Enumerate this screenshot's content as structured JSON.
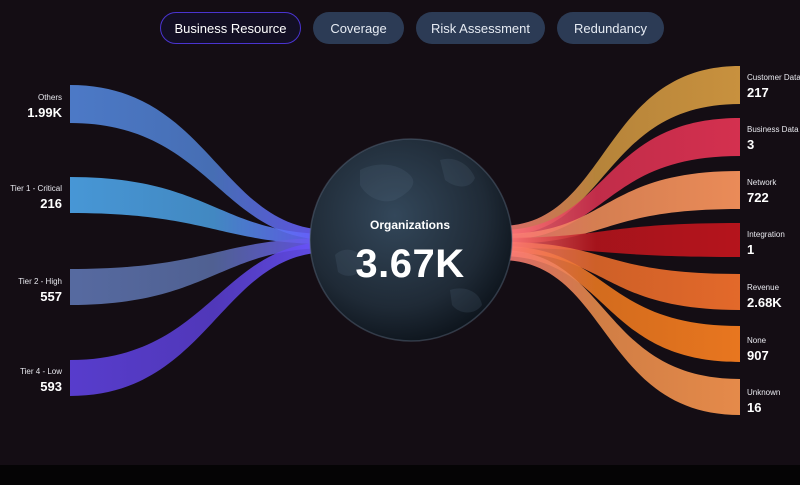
{
  "tabs": [
    {
      "label": "Business Resource",
      "active": true
    },
    {
      "label": "Coverage",
      "active": false
    },
    {
      "label": "Risk Assessment",
      "active": false
    },
    {
      "label": "Redundancy",
      "active": false
    }
  ],
  "center": {
    "title": "Organizations",
    "value": "3.67K"
  },
  "sources": [
    {
      "name": "Others",
      "value": "1.99K",
      "color": "#4f7fd0"
    },
    {
      "name": "Tier 1 - Critical",
      "value": "216",
      "color": "#4a9ee0"
    },
    {
      "name": "Tier 2 - High",
      "value": "557",
      "color": "#5a6fa8"
    },
    {
      "name": "Tier 4 - Low",
      "value": "593",
      "color": "#5b3fd6"
    }
  ],
  "targets": [
    {
      "name": "Customer Data",
      "value": "217",
      "color": "#c8913e"
    },
    {
      "name": "Business Data",
      "value": "3",
      "color": "#d4304f"
    },
    {
      "name": "Network",
      "value": "722",
      "color": "#ea8b58"
    },
    {
      "name": "Integration",
      "value": "1",
      "color": "#b5141c"
    },
    {
      "name": "Revenue",
      "value": "2.68K",
      "color": "#e3692a"
    },
    {
      "name": "None",
      "value": "907",
      "color": "#e8761f"
    },
    {
      "name": "Unknown",
      "value": "16",
      "color": "#e58a4a"
    }
  ],
  "colors": {
    "background": "#140d14",
    "tab_bg": "#2c3b55",
    "tab_active_border": "#4a34d0",
    "globe": "#1f2a36"
  }
}
